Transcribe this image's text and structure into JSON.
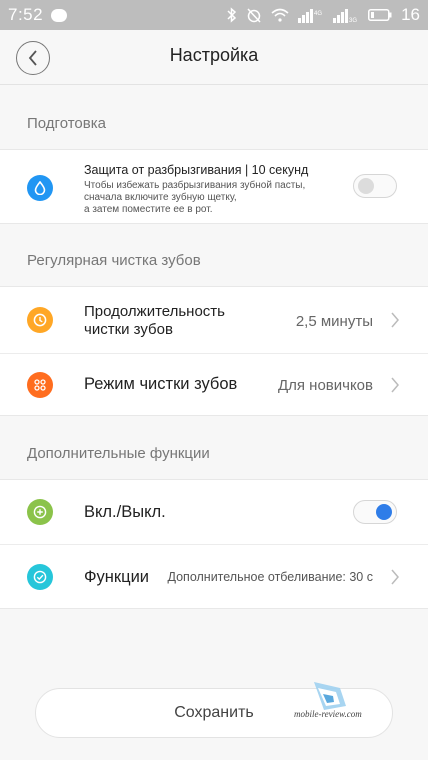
{
  "status_bar": {
    "time": "7:52",
    "network_4g": "4G",
    "network_3g": "3G",
    "battery": "16"
  },
  "header": {
    "title": "Настройка"
  },
  "sections": {
    "prep": {
      "title": "Подготовка",
      "splash": {
        "title": "Защита от разбрызгивания | 10 секунд",
        "desc1": "Чтобы избежать разбрызгивания зубной пасты,",
        "desc2": "сначала включите зубную щетку,",
        "desc3": "а затем поместите ее в рот.",
        "enabled": false,
        "icon": "water-drop-icon",
        "icon_color": "#2196f3"
      }
    },
    "regular": {
      "title": "Регулярная чистка зубов",
      "duration": {
        "title_line1": "Продолжительность",
        "title_line2": "чистки зубов",
        "value": "2,5 минуты",
        "icon": "clock-icon",
        "icon_color": "#ffa726"
      },
      "mode": {
        "title": "Режим чистки зубов",
        "value": "Для новичков",
        "icon": "grid-dots-icon",
        "icon_color": "#ff6d1f"
      }
    },
    "extra": {
      "title": "Дополнительные функции",
      "power": {
        "title": "Вкл./Выкл.",
        "enabled": true,
        "icon": "plus-circle-icon",
        "icon_color": "#8bc34a"
      },
      "functions": {
        "title": "Функции",
        "value": "Дополнительное отбеливание: 30 с",
        "icon": "check-circle-icon",
        "icon_color": "#26c6da"
      }
    }
  },
  "save_label": "Сохранить",
  "watermark": "mobile-review.com",
  "colors": {
    "toggle_on": "#2f7de8",
    "status_bar": "#bdbdbd"
  }
}
